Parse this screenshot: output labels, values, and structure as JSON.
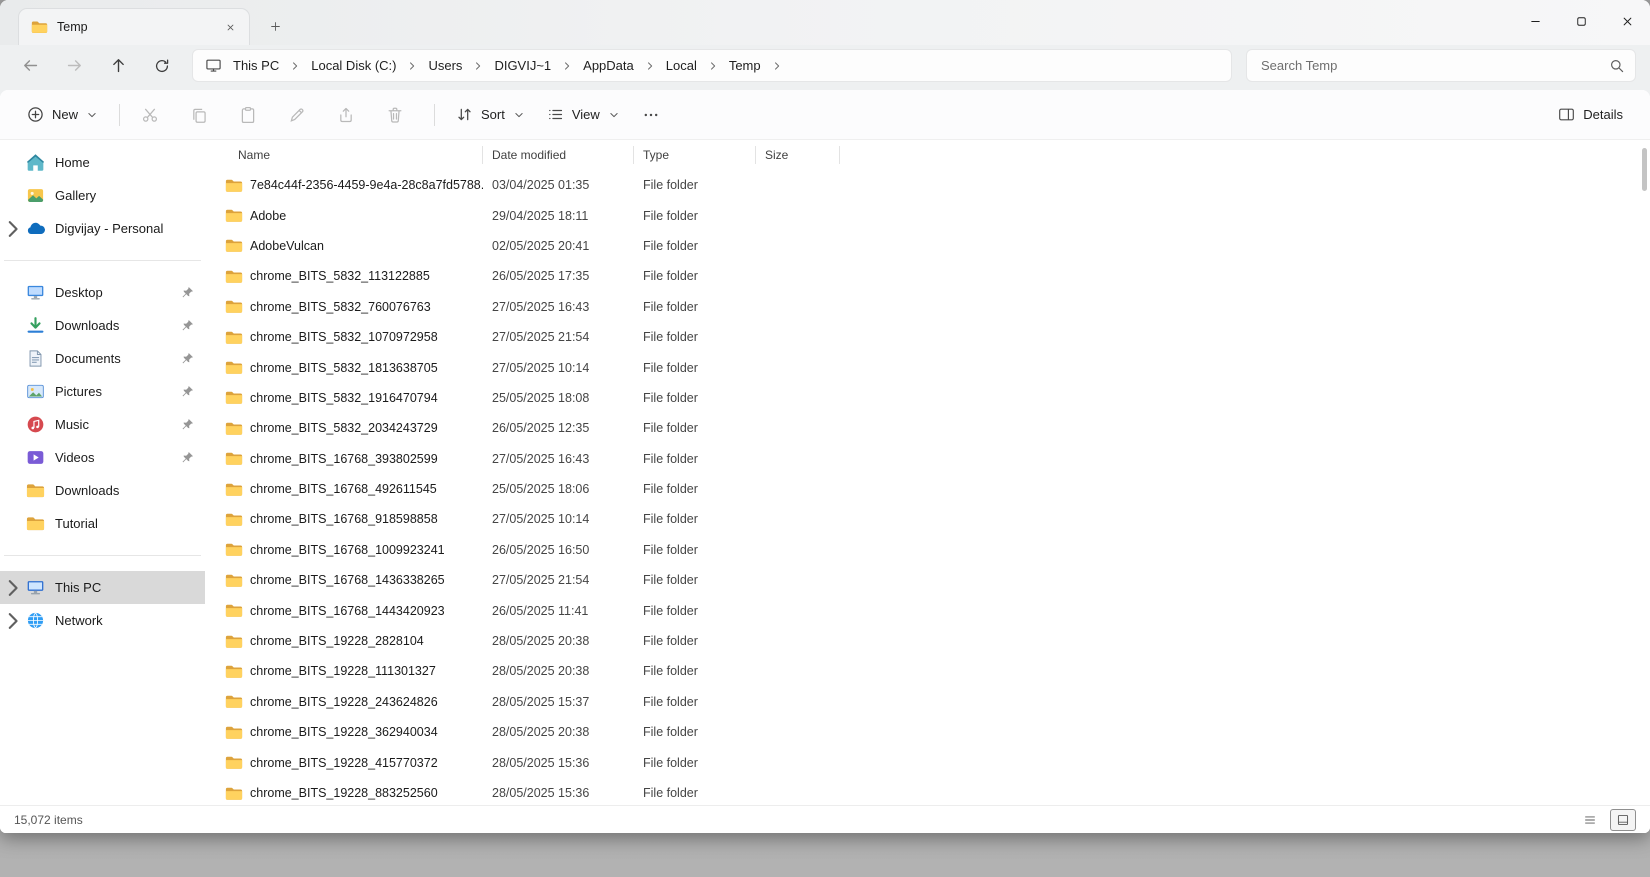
{
  "titlebar": {
    "tab_title": "Temp",
    "tab_icon": "folder-icon"
  },
  "window_controls": {
    "minimize": "minimize",
    "maximize": "maximize",
    "close": "close"
  },
  "navigation": {
    "back_icon": "back-icon",
    "forward_icon": "forward-icon",
    "up_icon": "up-icon",
    "refresh_icon": "refresh-icon"
  },
  "breadcrumb": {
    "device_icon": "monitor-icon",
    "items": [
      "This PC",
      "Local Disk (C:)",
      "Users",
      "DIGVIJ~1",
      "AppData",
      "Local",
      "Temp"
    ]
  },
  "search": {
    "placeholder": "Search Temp",
    "icon": "search-icon"
  },
  "commandbar": {
    "new_label": "New",
    "sort_label": "Sort",
    "view_label": "View",
    "details_label": "Details"
  },
  "sidebar": {
    "items": [
      {
        "label": "Home",
        "icon": "home-icon"
      },
      {
        "label": "Gallery",
        "icon": "gallery-icon"
      },
      {
        "label": "Digvijay - Personal",
        "icon": "onedrive-icon",
        "chevron": true
      },
      {
        "type": "separator"
      },
      {
        "label": "Desktop",
        "icon": "desktop-icon",
        "pinned": true
      },
      {
        "label": "Downloads",
        "icon": "downloads-icon",
        "pinned": true
      },
      {
        "label": "Documents",
        "icon": "documents-icon",
        "pinned": true
      },
      {
        "label": "Pictures",
        "icon": "pictures-icon",
        "pinned": true
      },
      {
        "label": "Music",
        "icon": "music-icon",
        "pinned": true
      },
      {
        "label": "Videos",
        "icon": "videos-icon",
        "pinned": true
      },
      {
        "label": "Downloads",
        "icon": "folder-icon"
      },
      {
        "label": "Tutorial",
        "icon": "folder-icon"
      },
      {
        "type": "separator"
      },
      {
        "label": "This PC",
        "icon": "thispc-icon",
        "chevron": true,
        "selected": true
      },
      {
        "label": "Network",
        "icon": "network-icon",
        "chevron": true
      }
    ]
  },
  "filelist": {
    "columns": [
      "Name",
      "Date modified",
      "Type",
      "Size"
    ],
    "row_icon": "folder-icon",
    "rows": [
      {
        "name": "7e84c44f-2356-4459-9e4a-28c8a7fd5788...",
        "modified": "03/04/2025 01:35",
        "type": "File folder",
        "size": ""
      },
      {
        "name": "Adobe",
        "modified": "29/04/2025 18:11",
        "type": "File folder",
        "size": ""
      },
      {
        "name": "AdobeVulcan",
        "modified": "02/05/2025 20:41",
        "type": "File folder",
        "size": ""
      },
      {
        "name": "chrome_BITS_5832_113122885",
        "modified": "26/05/2025 17:35",
        "type": "File folder",
        "size": ""
      },
      {
        "name": "chrome_BITS_5832_760076763",
        "modified": "27/05/2025 16:43",
        "type": "File folder",
        "size": ""
      },
      {
        "name": "chrome_BITS_5832_1070972958",
        "modified": "27/05/2025 21:54",
        "type": "File folder",
        "size": ""
      },
      {
        "name": "chrome_BITS_5832_1813638705",
        "modified": "27/05/2025 10:14",
        "type": "File folder",
        "size": ""
      },
      {
        "name": "chrome_BITS_5832_1916470794",
        "modified": "25/05/2025 18:08",
        "type": "File folder",
        "size": ""
      },
      {
        "name": "chrome_BITS_5832_2034243729",
        "modified": "26/05/2025 12:35",
        "type": "File folder",
        "size": ""
      },
      {
        "name": "chrome_BITS_16768_393802599",
        "modified": "27/05/2025 16:43",
        "type": "File folder",
        "size": ""
      },
      {
        "name": "chrome_BITS_16768_492611545",
        "modified": "25/05/2025 18:06",
        "type": "File folder",
        "size": ""
      },
      {
        "name": "chrome_BITS_16768_918598858",
        "modified": "27/05/2025 10:14",
        "type": "File folder",
        "size": ""
      },
      {
        "name": "chrome_BITS_16768_1009923241",
        "modified": "26/05/2025 16:50",
        "type": "File folder",
        "size": ""
      },
      {
        "name": "chrome_BITS_16768_1436338265",
        "modified": "27/05/2025 21:54",
        "type": "File folder",
        "size": ""
      },
      {
        "name": "chrome_BITS_16768_1443420923",
        "modified": "26/05/2025 11:41",
        "type": "File folder",
        "size": ""
      },
      {
        "name": "chrome_BITS_19228_2828104",
        "modified": "28/05/2025 20:38",
        "type": "File folder",
        "size": ""
      },
      {
        "name": "chrome_BITS_19228_111301327",
        "modified": "28/05/2025 20:38",
        "type": "File folder",
        "size": ""
      },
      {
        "name": "chrome_BITS_19228_243624826",
        "modified": "28/05/2025 15:37",
        "type": "File folder",
        "size": ""
      },
      {
        "name": "chrome_BITS_19228_362940034",
        "modified": "28/05/2025 20:38",
        "type": "File folder",
        "size": ""
      },
      {
        "name": "chrome_BITS_19228_415770372",
        "modified": "28/05/2025 15:36",
        "type": "File folder",
        "size": ""
      },
      {
        "name": "chrome_BITS_19228_883252560",
        "modified": "28/05/2025 15:36",
        "type": "File folder",
        "size": ""
      }
    ]
  },
  "statusbar": {
    "items_text": "15,072 items"
  },
  "colors": {
    "folder_front": "#ffd25f",
    "folder_back": "#dda33c",
    "selection_gray": "#d9d9d9",
    "chrome_gray": "#eef0f1"
  }
}
